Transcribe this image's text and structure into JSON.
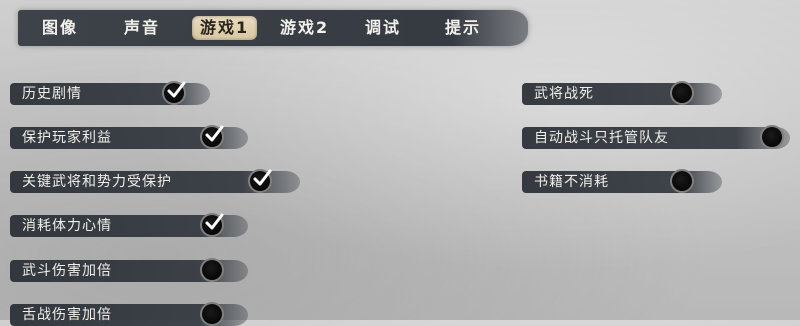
{
  "tabs": [
    {
      "label": "图像"
    },
    {
      "label": "声音"
    },
    {
      "label": "游戏1",
      "active": true
    },
    {
      "label": "游戏2"
    },
    {
      "label": "调试"
    },
    {
      "label": "提示"
    }
  ],
  "left_options": [
    {
      "label": "历史剧情",
      "checked": true
    },
    {
      "label": "保护玩家利益",
      "checked": true
    },
    {
      "label": "关键武将和势力受保护",
      "checked": true
    },
    {
      "label": "消耗体力心情",
      "checked": true
    },
    {
      "label": "武斗伤害加倍",
      "checked": false
    },
    {
      "label": "舌战伤害加倍",
      "checked": false
    }
  ],
  "right_options": [
    {
      "label": "武将战死",
      "checked": false
    },
    {
      "label": "自动战斗只托管队友",
      "checked": false
    },
    {
      "label": "书籍不消耗",
      "checked": false
    }
  ]
}
